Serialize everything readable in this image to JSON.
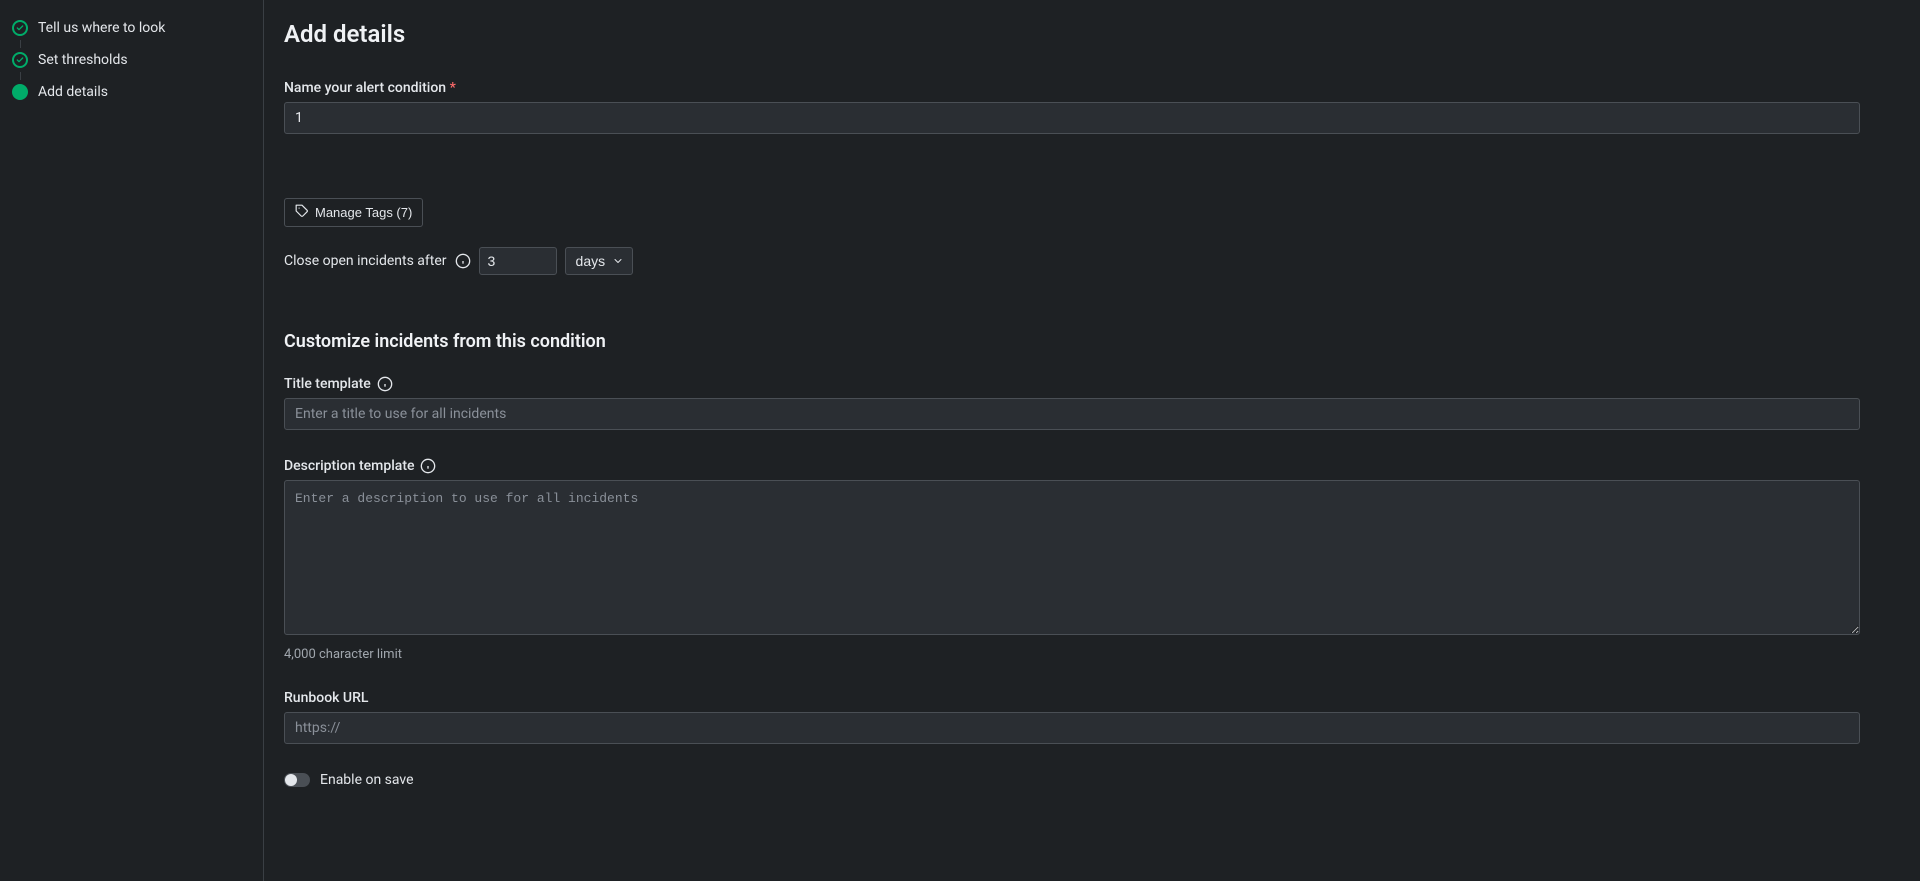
{
  "sidebar": {
    "steps": [
      {
        "label": "Tell us where to look",
        "status": "completed"
      },
      {
        "label": "Set thresholds",
        "status": "completed"
      },
      {
        "label": "Add details",
        "status": "current"
      }
    ]
  },
  "page": {
    "title": "Add details"
  },
  "nameField": {
    "label": "Name your alert condition",
    "requiredMark": "*",
    "value": "1"
  },
  "manageTags": {
    "label": "Manage Tags (7)"
  },
  "closeIncidents": {
    "label": "Close open incidents after",
    "value": "3",
    "unit": "days"
  },
  "customizeSection": {
    "header": "Customize incidents from this condition"
  },
  "titleTemplate": {
    "label": "Title template",
    "placeholder": "Enter a title to use for all incidents",
    "value": ""
  },
  "descriptionTemplate": {
    "label": "Description template",
    "placeholder": "Enter a description to use for all incidents",
    "value": "",
    "help": "4,000 character limit"
  },
  "runbook": {
    "label": "Runbook URL",
    "placeholder": "https://",
    "value": ""
  },
  "enableToggle": {
    "label": "Enable on save",
    "value": false
  }
}
